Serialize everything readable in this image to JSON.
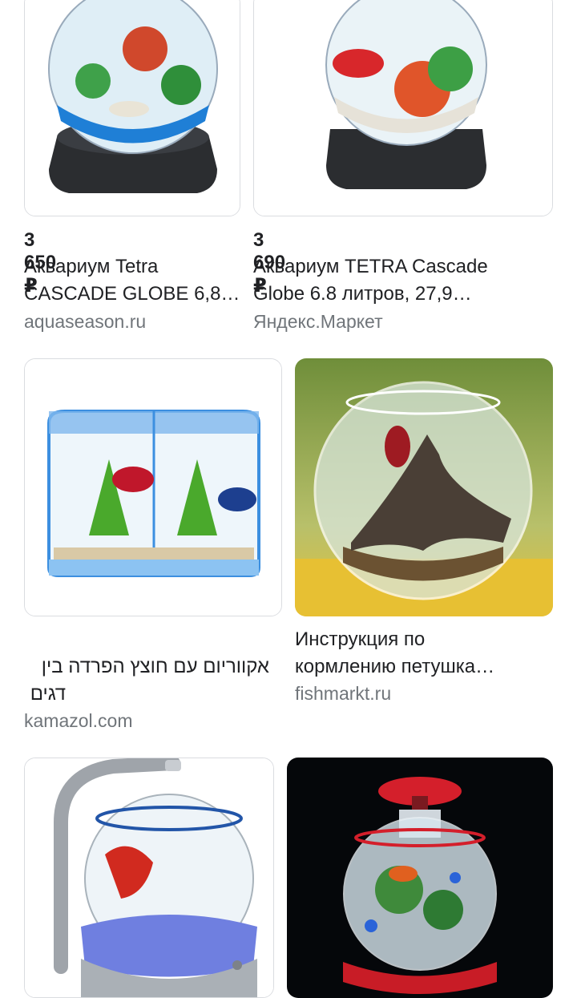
{
  "results": [
    {
      "price": "3 650 ₽",
      "title_line1": "Аквариум Tetra",
      "title_line2": "CASCADE GLOBE 6,8…",
      "source": "aquaseason.ru",
      "image": "globe-aquarium-black-base"
    },
    {
      "price": "3 690 ₽",
      "title_line1": "Аквариум TETRA Cascade",
      "title_line2": "Globe 6.8 литров, 27,9…",
      "source": "Яндекс.Маркет",
      "image": "globe-aquarium-red-betta"
    },
    {
      "title_line1": "אקווריום עם חוצץ הפרדה בין",
      "title_line2": "דגים",
      "source": "kamazol.com",
      "image": "divided-betta-tank"
    },
    {
      "title_line1": "Инструкция по",
      "title_line2": "кормлению петушка…",
      "source": "fishmarkt.ru",
      "image": "round-bowl-driftwood"
    },
    {
      "image": "bowl-with-arc-lamp"
    },
    {
      "image": "bowl-with-red-lid-black-background"
    }
  ]
}
